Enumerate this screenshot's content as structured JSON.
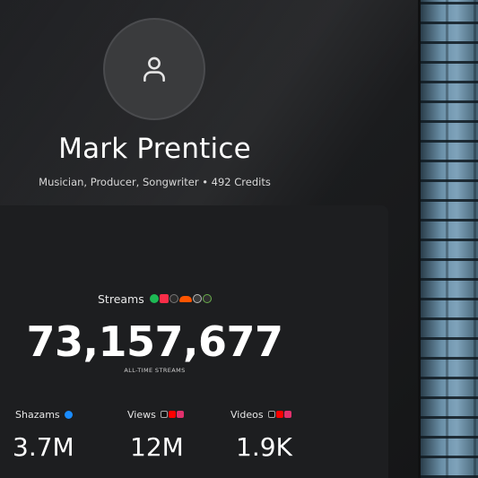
{
  "profile": {
    "name": "Mark Prentice",
    "bio": "Musician, Producer, Songwriter • 492 Credits",
    "avatar_icon": "user-icon"
  },
  "streams": {
    "label": "Streams",
    "total": "73,157,677",
    "sublabel": "ALL-TIME STREAMS",
    "platform_icons": [
      "spotify-icon",
      "apple-music-icon",
      "tidal-icon",
      "soundcloud-icon",
      "deezer-icon",
      "pandora-icon"
    ]
  },
  "stats": [
    {
      "label": "Shazams",
      "value": "3.7M",
      "icons": [
        "shazam-icon"
      ]
    },
    {
      "label": "Views",
      "value": "12M",
      "icons": [
        "tiktok-icon",
        "youtube-icon",
        "instagram-icon"
      ]
    },
    {
      "label": "Videos",
      "value": "1.9K",
      "icons": [
        "tiktok-icon",
        "youtube-icon",
        "instagram-icon"
      ]
    }
  ],
  "colors": {
    "panel": "#1b1c1e",
    "spotify": "#1db954",
    "apple_music": "#fa2d48",
    "soundcloud": "#ff5500",
    "shazam": "#1a8cff",
    "youtube": "#ff0000",
    "instagram": "#e1306c",
    "brick": "#6b90a8"
  }
}
